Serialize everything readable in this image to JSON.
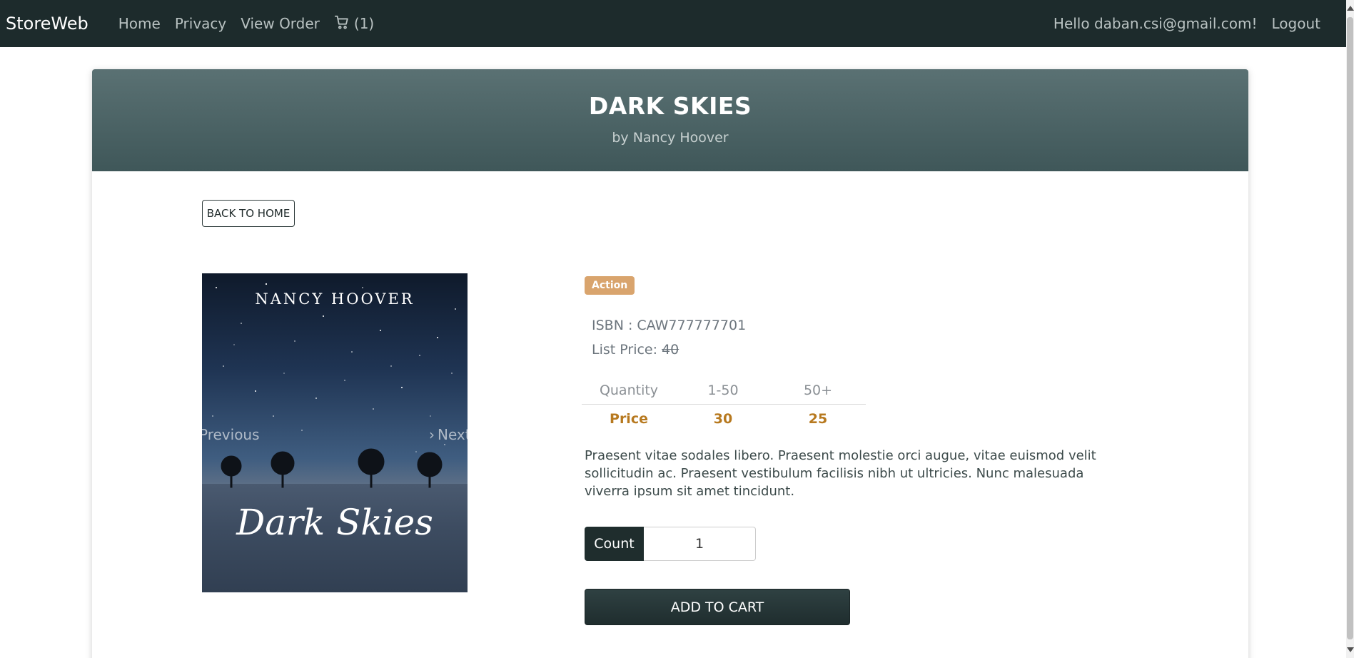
{
  "navbar": {
    "brand": "StoreWeb",
    "links": [
      "Home",
      "Privacy",
      "View Order"
    ],
    "cart_count": "(1)",
    "greeting": "Hello daban.csi@gmail.com!",
    "logout": "Logout"
  },
  "product": {
    "title": "DARK SKIES",
    "author": "by Nancy Hoover",
    "back_label": "BACK TO HOME",
    "cover": {
      "author_text": "NANCY HOOVER",
      "title_text": "Dark Skies",
      "prev_label": "Previous",
      "next_label": "Next"
    },
    "category": "Action",
    "isbn_label": "ISBN : CAW777777701",
    "list_price_label": "List Price: ",
    "list_price_value": "40",
    "price_table": {
      "headers": [
        "Quantity",
        "1-50",
        "50+"
      ],
      "values": [
        "Price",
        "30",
        "25"
      ]
    },
    "description": "Praesent vitae sodales libero. Praesent molestie orci augue, vitae euismod velit sollicitudin ac. Praesent vestibulum facilisis nibh ut ultricies. Nunc malesuada viverra ipsum sit amet tincidunt.",
    "count_label": "Count",
    "count_value": "1",
    "add_to_cart": "ADD TO CART"
  },
  "colors": {
    "navbar_bg": "#1d2b2c",
    "header_bg": "#4f6668",
    "badge_bg": "#d9a46d",
    "price_color": "#b7791f"
  }
}
